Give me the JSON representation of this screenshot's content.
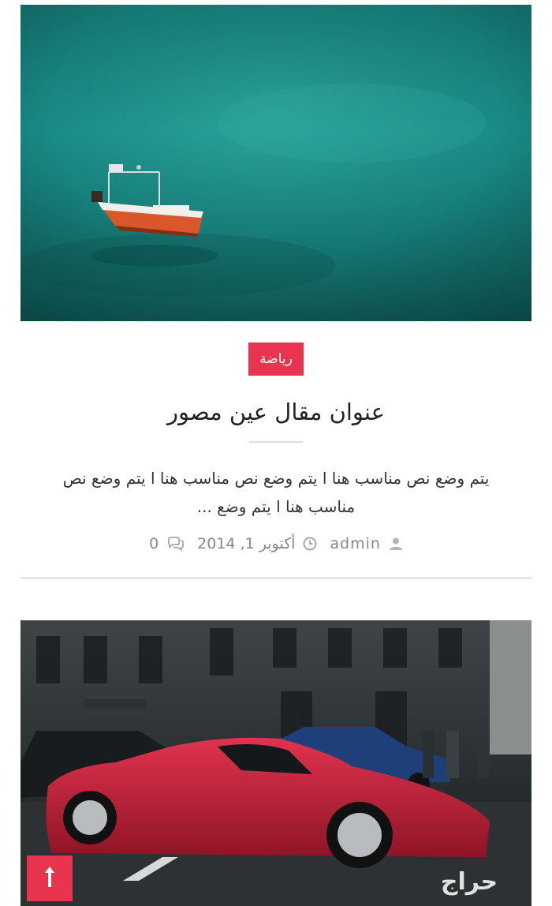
{
  "posts": [
    {
      "image": "boat-on-turquoise-sea",
      "category": "رياضة",
      "title": "عنوان مقال عين مصور",
      "excerpt": "يتم وضع نص مناسب هنا ا يتم وضع نص مناسب هنا ا يتم وضع نص مناسب هنا ا يتم وضع ...",
      "author": "admin",
      "date": "أكتوبر 1, 2014",
      "comments": "0",
      "icons": {
        "author": "user-icon",
        "date": "clock-icon",
        "comments": "comments-icon"
      }
    },
    {
      "image": "red-sports-car-city-street"
    }
  ],
  "scroll_top": {
    "icon": "arrow-up-icon",
    "label": "↑"
  },
  "watermark": {
    "text": "حراج"
  },
  "colors": {
    "accent": "#e8344e",
    "text": "#222222",
    "meta": "#888888",
    "divider": "#e6e6e6"
  }
}
